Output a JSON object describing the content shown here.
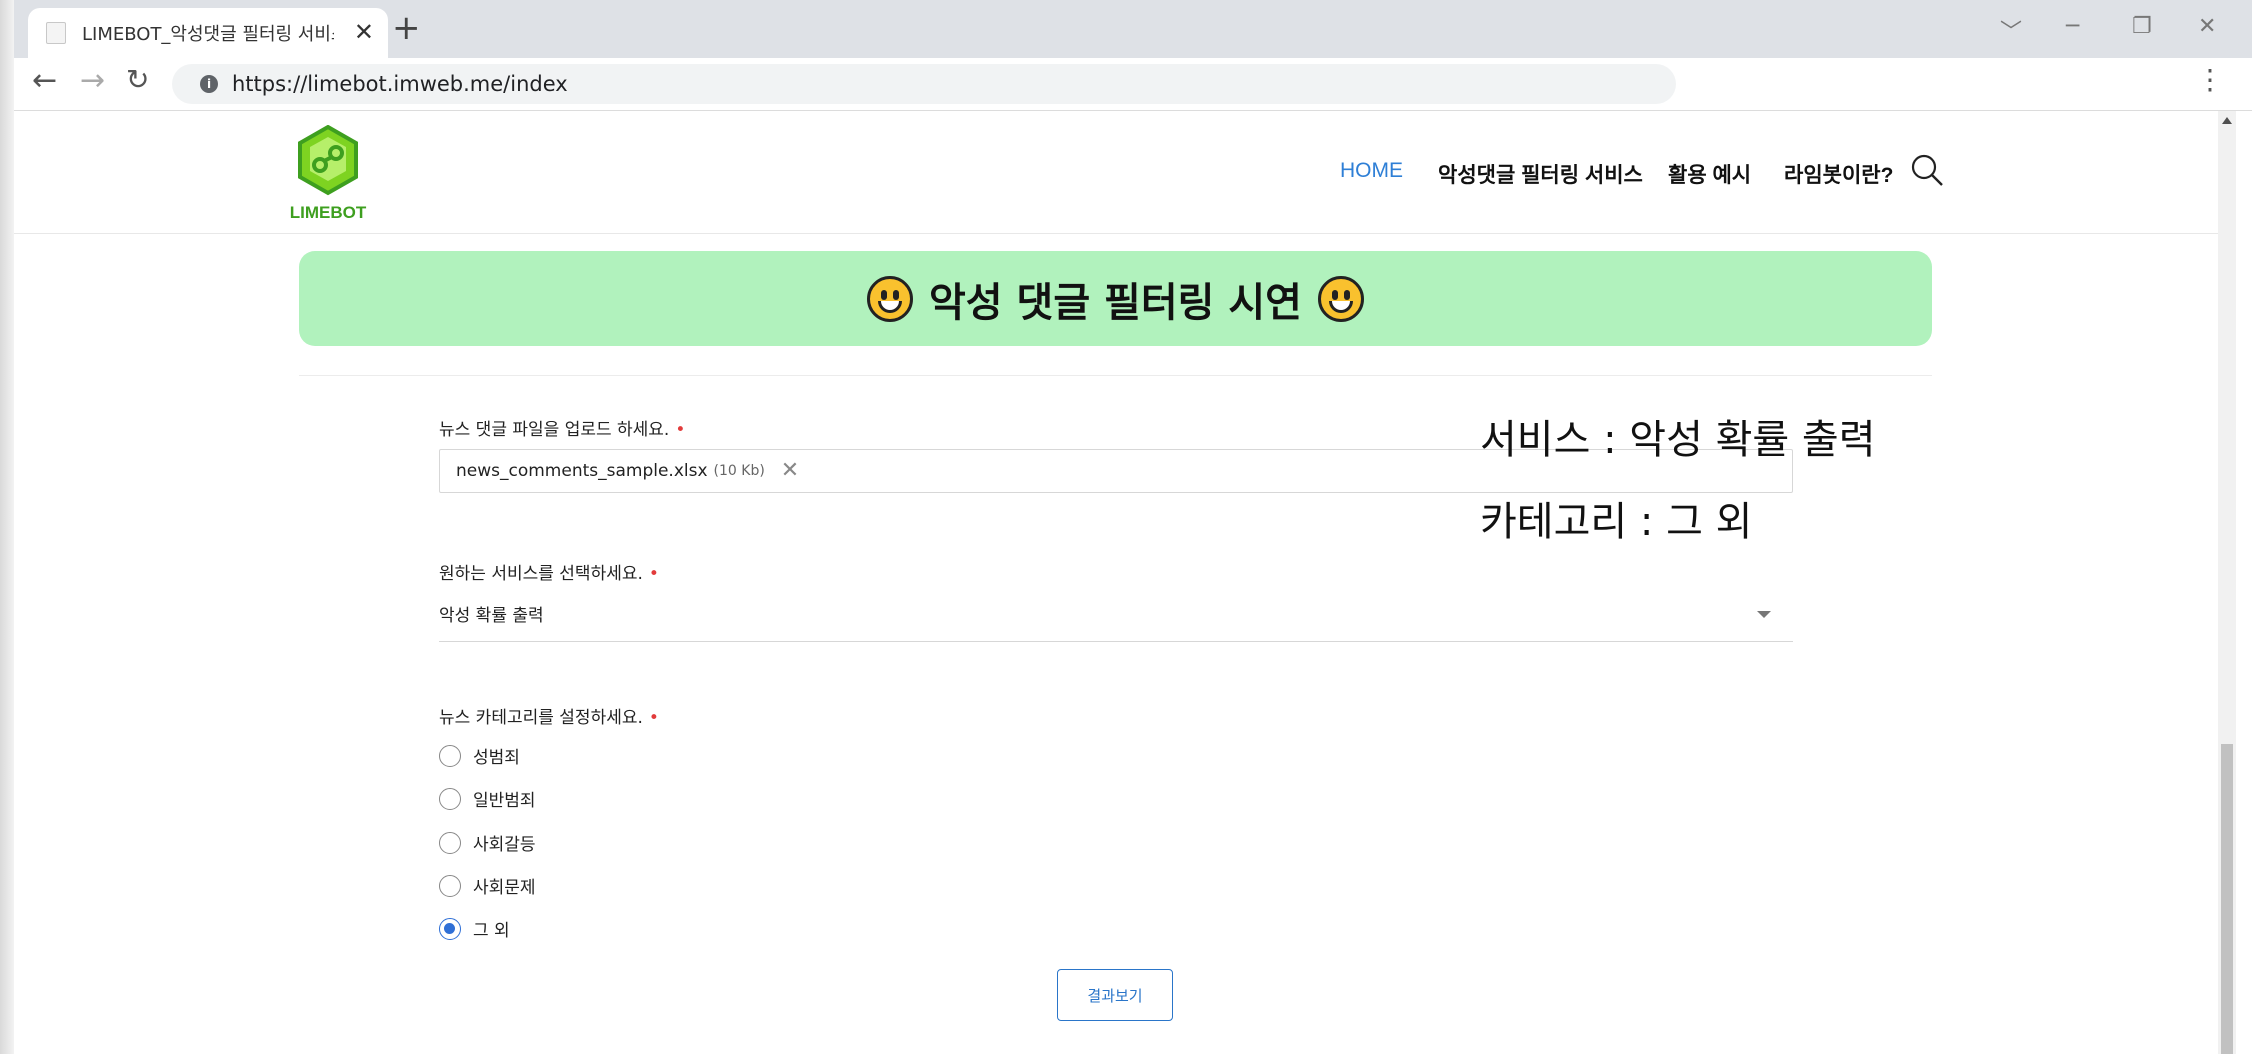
{
  "browser": {
    "tab_title": "LIMEBOT_악성댓글 필터링 서비스",
    "tab_close": "✕",
    "new_tab": "+",
    "url": "https://limebot.imweb.me/index",
    "window_controls": [
      "﹀",
      "─",
      "❐",
      "✕"
    ]
  },
  "site": {
    "logo_text": "LIMEBOT",
    "nav": [
      "HOME",
      "악성댓글 필터링 서비스",
      "활용 예시",
      "라임봇이란?"
    ],
    "active_nav": "HOME"
  },
  "banner": {
    "title": "악성 댓글 필터링 시연"
  },
  "form": {
    "upload": {
      "label": "뉴스 댓글 파일을 업로드 하세요.",
      "required_mark": "•",
      "file_name": "news_comments_sample.xlsx",
      "file_size": "(10 Kb)",
      "remove_icon": "✕"
    },
    "service": {
      "label": "원하는 서비스를 선택하세요.",
      "required_mark": "•",
      "selected": "악성 확률 출력"
    },
    "category": {
      "label": "뉴스 카테고리를 설정하세요.",
      "required_mark": "•",
      "options": [
        "성범죄",
        "일반범죄",
        "사회갈등",
        "사회문제",
        "그 외"
      ],
      "selected_index": 4
    },
    "submit_label": "결과보기"
  },
  "overlay": {
    "service_note": "서비스 : 악성 확률 출력",
    "category_note": "카테고리 : 그 외"
  },
  "colors": {
    "banner_bg": "#b1f2bd",
    "accent_blue": "#2e7fd6",
    "required_red": "#e23b3b",
    "logo_green": "#3e9f1f"
  }
}
